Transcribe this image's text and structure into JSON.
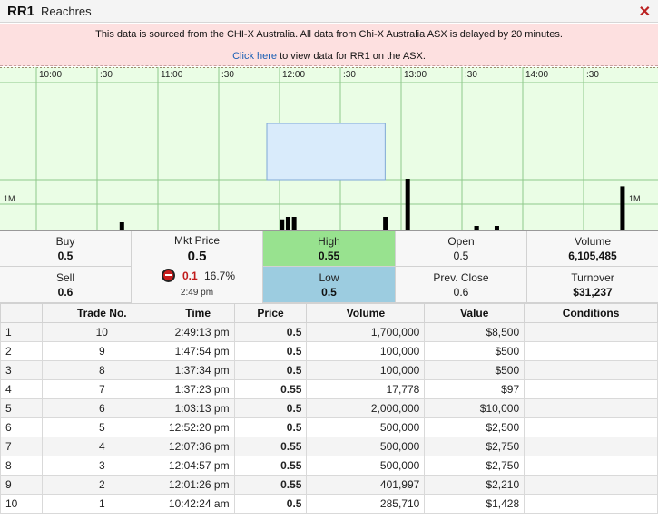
{
  "header": {
    "code": "RR1",
    "company": "Reachres",
    "close_glyph": "✕"
  },
  "notice": {
    "line1": "This data is sourced from the CHI-X Australia. All data from Chi-X Australia ASX is delayed by 20 minutes.",
    "link_text": "Click here",
    "line2_rest": " to view data for RR1 on the ASX."
  },
  "chart": {
    "time_labels": [
      "10:00",
      ":30",
      "11:00",
      ":30",
      "12:00",
      ":30",
      "13:00",
      ":30",
      "14:00",
      ":30"
    ],
    "volume_label_left": "1M",
    "volume_label_right": "1M",
    "price_range_box": {
      "start": "12:00",
      "end": "12:53"
    },
    "colors": {
      "background": "#eafde5",
      "grid": "#8fc98a",
      "bar": "#000000",
      "range_box": "#d9ebfb"
    }
  },
  "quote": {
    "buy": {
      "label": "Buy",
      "value": "0.5"
    },
    "sell": {
      "label": "Sell",
      "value": "0.6"
    },
    "mkt": {
      "label": "Mkt Price",
      "value": "0.5",
      "change": "0.1",
      "change_pct": "16.7%",
      "time": "2:49 pm"
    },
    "high": {
      "label": "High",
      "value": "0.55"
    },
    "low": {
      "label": "Low",
      "value": "0.5"
    },
    "open": {
      "label": "Open",
      "value": "0.5"
    },
    "prev_close": {
      "label": "Prev. Close",
      "value": "0.6"
    },
    "volume": {
      "label": "Volume",
      "value": "6,105,485"
    },
    "turnover": {
      "label": "Turnover",
      "value": "$31,237"
    }
  },
  "table": {
    "headers": [
      "",
      "Trade No.",
      "Time",
      "Price",
      "Volume",
      "Value",
      "Conditions"
    ],
    "rows": [
      [
        "1",
        "10",
        "2:49:13 pm",
        "0.5",
        "1,700,000",
        "$8,500",
        ""
      ],
      [
        "2",
        "9",
        "1:47:54 pm",
        "0.5",
        "100,000",
        "$500",
        ""
      ],
      [
        "3",
        "8",
        "1:37:34 pm",
        "0.5",
        "100,000",
        "$500",
        ""
      ],
      [
        "4",
        "7",
        "1:37:23 pm",
        "0.55",
        "17,778",
        "$97",
        ""
      ],
      [
        "5",
        "6",
        "1:03:13 pm",
        "0.5",
        "2,000,000",
        "$10,000",
        ""
      ],
      [
        "6",
        "5",
        "12:52:20 pm",
        "0.5",
        "500,000",
        "$2,500",
        ""
      ],
      [
        "7",
        "4",
        "12:07:36 pm",
        "0.55",
        "500,000",
        "$2,750",
        ""
      ],
      [
        "8",
        "3",
        "12:04:57 pm",
        "0.55",
        "500,000",
        "$2,750",
        ""
      ],
      [
        "9",
        "2",
        "12:01:26 pm",
        "0.55",
        "401,997",
        "$2,210",
        ""
      ],
      [
        "10",
        "1",
        "10:42:24 am",
        "0.5",
        "285,710",
        "$1,428",
        ""
      ]
    ]
  }
}
